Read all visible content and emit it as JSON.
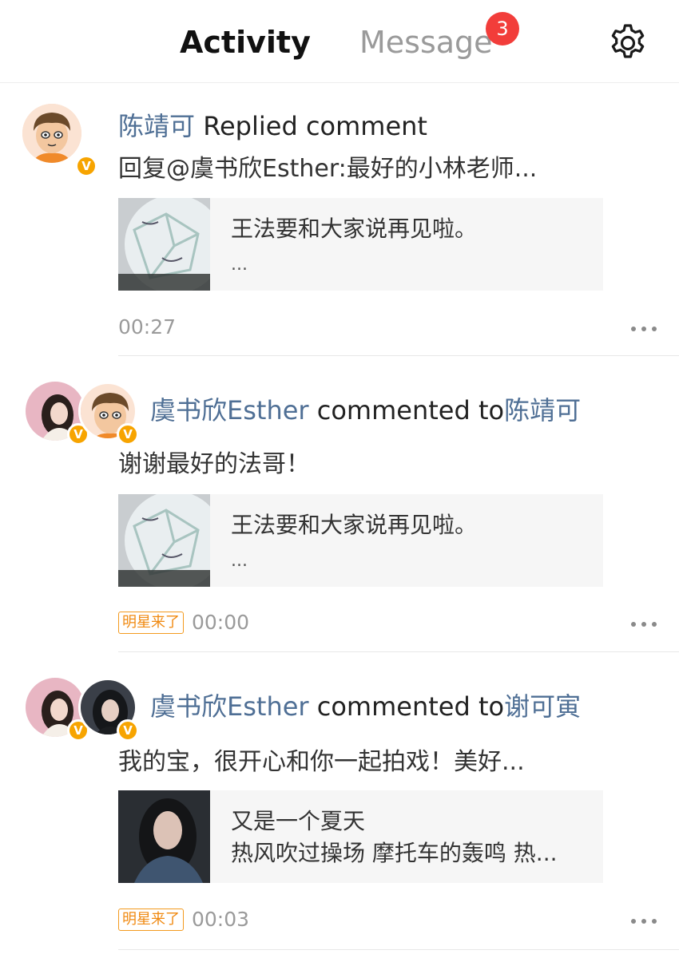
{
  "header": {
    "tabs": [
      {
        "label": "Activity",
        "active": true
      },
      {
        "label": "Message",
        "active": false
      }
    ],
    "message_badge": "3",
    "settings_icon": "gear-icon",
    "accent_color": "#f7a91b",
    "badge_color": "#f23d3a"
  },
  "feed": [
    {
      "name": "陈靖可",
      "action": " Replied comment",
      "target": "",
      "content": "回复@虞书欣Esther:最好的小林老师...",
      "card": {
        "line1": "王法要和大家说再见啦。",
        "line2": "..."
      },
      "tag": "",
      "time": "00:27"
    },
    {
      "name": "虞书欣Esther",
      "action": " commented to",
      "target": "陈靖可",
      "content": "谢谢最好的法哥！",
      "card": {
        "line1": "王法要和大家说再见啦。",
        "line2": "..."
      },
      "tag": "明星来了",
      "time": "00:00"
    },
    {
      "name": "虞书欣Esther",
      "action": " commented to",
      "target": "谢可寅",
      "content": "我的宝，很开心和你一起拍戏！美好...",
      "card": {
        "line1": "又是一个夏天",
        "line2": "热风吹过操场 摩托车的轰鸣 热..."
      },
      "tag": "明星来了",
      "time": "00:03"
    }
  ],
  "verified_badge": "V",
  "name_color": "#4f6f95"
}
